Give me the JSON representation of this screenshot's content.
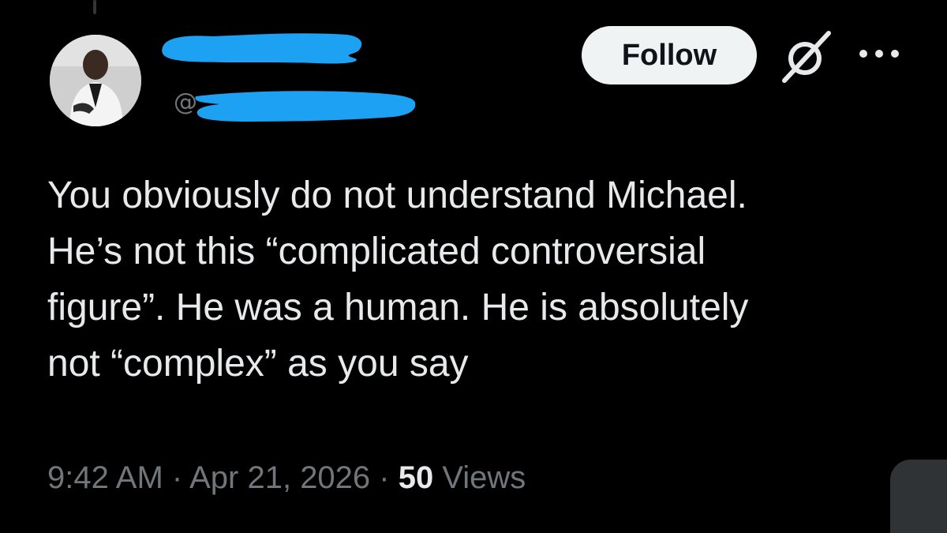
{
  "post": {
    "author": {
      "handle_prefix": "@"
    },
    "follow_label": "Follow",
    "text": "You obviously do not understand Michael.\nHe’s not this “complicated controversial\nfigure”. He was a human. He is absolutely\nnot “complex” as you say",
    "time": "9:42 AM",
    "separator": " · ",
    "date": "Apr 21, 2026",
    "views_count": "50",
    "views_label": " Views"
  },
  "icons": {
    "avatar": "avatar-photo",
    "grok": "grok-icon",
    "more": "more-dots-icon"
  },
  "colors": {
    "background": "#000000",
    "text_primary": "#e7e9ea",
    "text_secondary": "#71767b",
    "follow_bg": "#eff3f4",
    "follow_text": "#0f1419",
    "redaction": "#1da1f2"
  }
}
